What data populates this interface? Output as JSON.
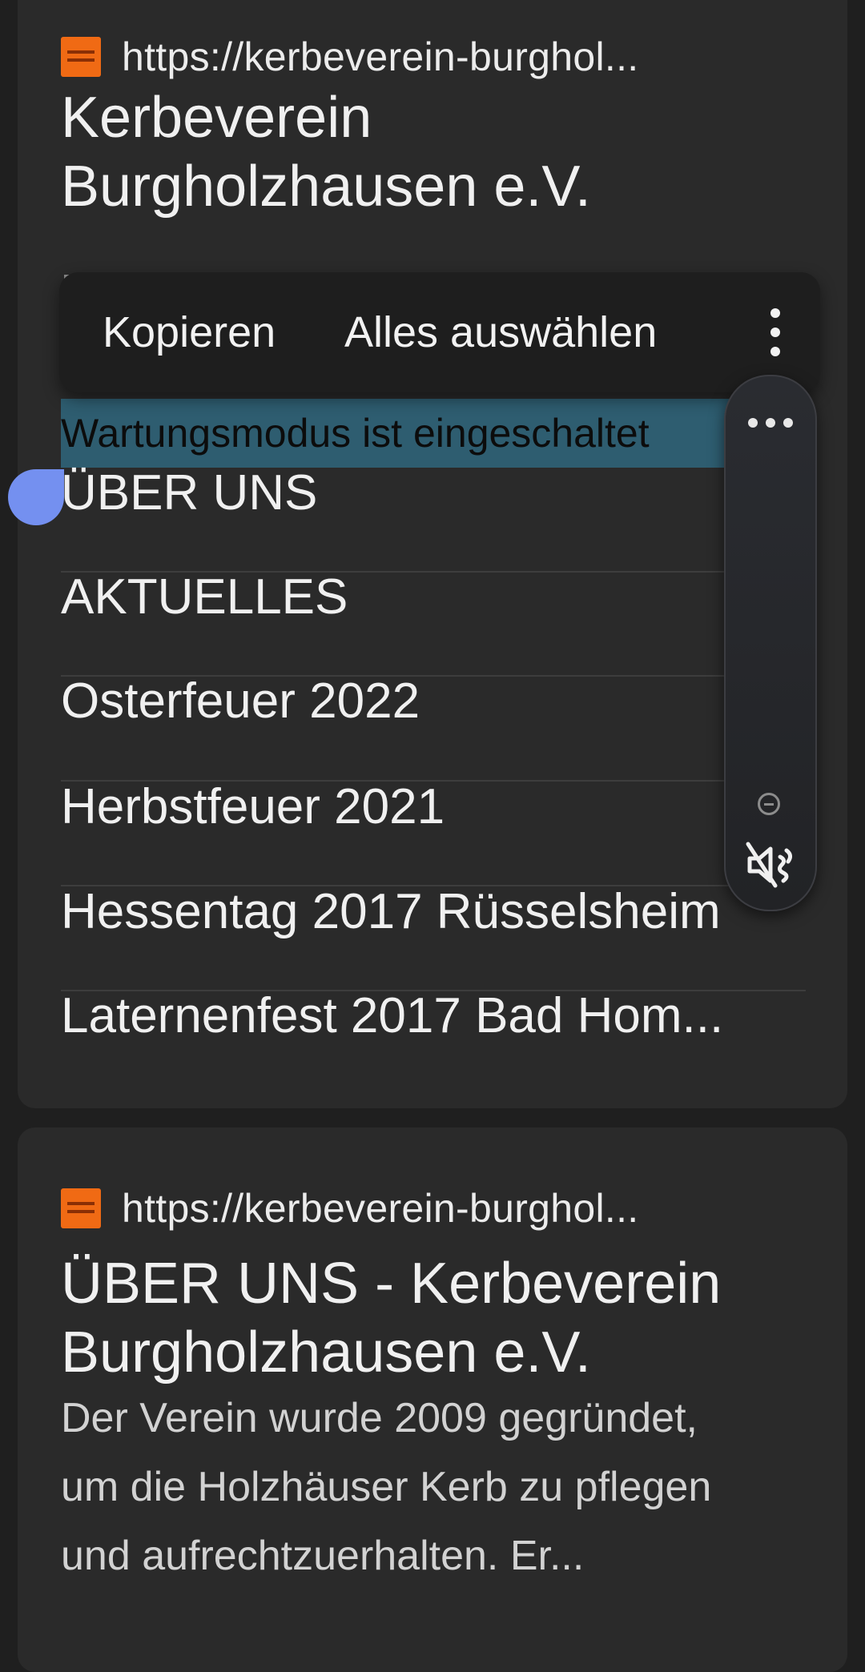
{
  "result1": {
    "url": "https://kerbeverein-burghol...",
    "title_line1": "Kerbeverein",
    "title_line2": "Burgholzhausen e.V.",
    "selected_text": "Wartungsmodus ist eingeschaltet",
    "links": [
      "ÜBER UNS",
      "AKTUELLES",
      "Osterfeuer 2022",
      "Herbstfeuer 2021",
      "Hessentag 2017 Rüsselsheim",
      "Laternenfest 2017 Bad Hom..."
    ]
  },
  "toolbar": {
    "copy": "Kopieren",
    "select_all": "Alles auswählen"
  },
  "result2": {
    "url": "https://kerbeverein-burghol...",
    "title_line1": "ÜBER UNS - Kerbeverein",
    "title_line2": "Burgholzhausen e.V.",
    "snippet_line1": "Der Verein wurde 2009 gegründet,",
    "snippet_line2": "um die Holzhäuser Kerb zu pflegen",
    "snippet_line3": "und aufrechtzuerhalten. Er..."
  },
  "colors": {
    "favicon": "#f06a14",
    "selection": "#2e5d70",
    "handle": "#7490f0"
  },
  "icons": [
    "favicon-icon",
    "more-vert-icon",
    "more-horiz-icon",
    "minus-circle-icon",
    "volume-mute-icon"
  ]
}
